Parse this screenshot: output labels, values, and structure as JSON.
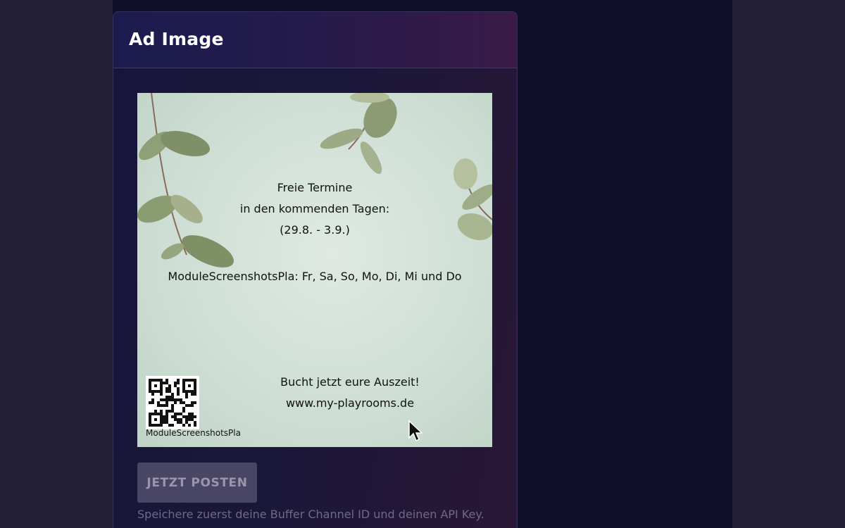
{
  "card": {
    "title": "Ad Image"
  },
  "ad": {
    "lines": [
      "Freie Termine",
      "in den kommenden Tagen:",
      "(29.8. - 3.9.)",
      "ModuleScreenshotsPla: Fr, Sa, So, Mo, Di, Mi und Do",
      "Bucht jetzt eure Auszeit!",
      "www.my-playrooms.de"
    ],
    "qr_caption": "ModuleScreenshotsPla"
  },
  "actions": {
    "post_label": "JETZT POSTEN",
    "hint": "Speichere zuerst deine Buffer Channel ID und deinen API Key."
  },
  "colors": {
    "page_bg": "#231f37",
    "column_bg": "#100e2a",
    "ad_bg": "#d3e2d8",
    "button_bg": "#494564"
  }
}
